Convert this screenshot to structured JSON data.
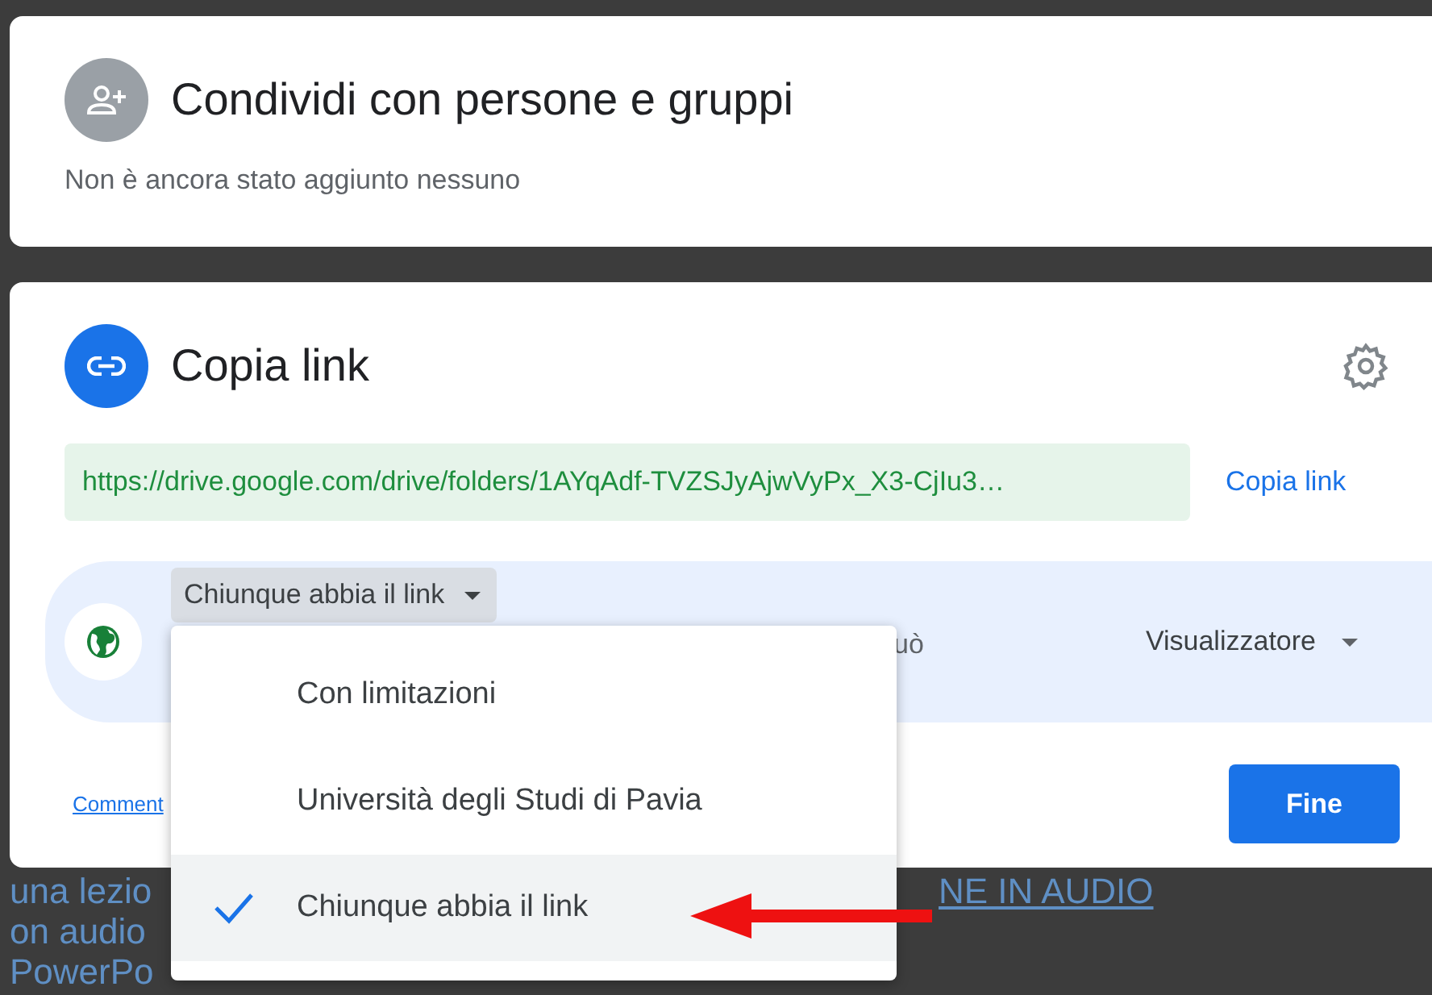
{
  "share_card": {
    "title": "Condividi con persone e gruppi",
    "subtitle": "Non è ancora stato aggiunto nessuno"
  },
  "link_card": {
    "title": "Copia link",
    "url": "https://drive.google.com/drive/folders/1AYqAdf-TVZSJyAjwVyPx_X3-CjIu3…",
    "copy_button": "Copia link",
    "access_dropdown": "Chiunque abbia il link",
    "access_hint": "uò",
    "role_dropdown": "Visualizzatore",
    "feedback_link": "Comment",
    "done_button": "Fine"
  },
  "access_menu": [
    {
      "label": "Con limitazioni",
      "selected": false
    },
    {
      "label": "Università degli Studi di Pavia",
      "selected": false
    },
    {
      "label": "Chiunque abbia il link",
      "selected": true
    }
  ],
  "background_texts": [
    "una lezio",
    "on audio",
    "PowerPo",
    "NE IN AUDIO"
  ]
}
